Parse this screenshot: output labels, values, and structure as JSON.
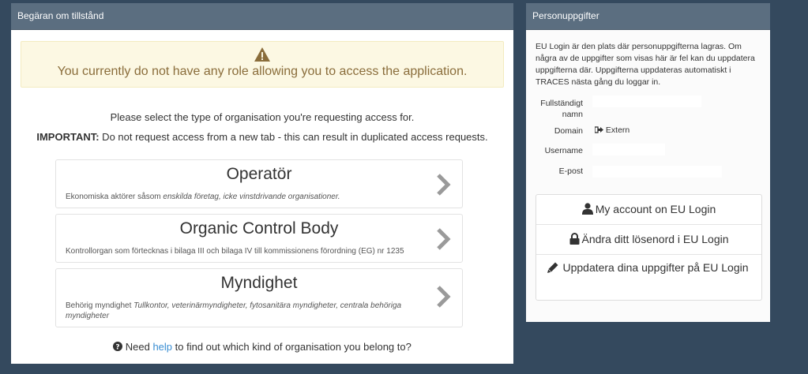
{
  "left_panel": {
    "title": "Begäran om tillstånd",
    "alert_text": "You currently do not have any role allowing you to access the application.",
    "intro": "Please select the type of organisation you're requesting access for.",
    "important_label": "IMPORTANT:",
    "important_text": " Do not request access from a new tab - this can result in duplicated access requests.",
    "orgs": [
      {
        "title": "Operatör",
        "desc_plain": "Ekonomiska aktörer såsom ",
        "desc_italic": "enskilda företag, icke vinstdrivande organisationer."
      },
      {
        "title": "Organic Control Body",
        "desc_plain": "Kontrollorgan som förtecknas i bilaga III och bilaga IV till kommissionens förordning (EG) nr 1235",
        "desc_italic": ""
      },
      {
        "title": "Myndighet",
        "desc_plain": "Behörig myndighet ",
        "desc_italic": "Tullkontor, veterinärmyndigheter, fytosanitära myndigheter, centrala behöriga myndigheter"
      }
    ],
    "help_prefix": " Need ",
    "help_link": "help",
    "help_suffix": " to find out which kind of organisation you belong to?"
  },
  "right_panel": {
    "title": "Personuppgifter",
    "info": "EU Login är den plats där personuppgifterna lagras. Om några av de uppgifter som visas här är fel kan du uppdatera uppgifterna där. Uppgifterna uppdateras automatiskt i TRACES nästa gång du loggar in.",
    "fields": {
      "fullname_label": "Fullständigt namn",
      "domain_label": "Domain",
      "domain_value": "Extern",
      "username_label": "Username",
      "email_label": "E-post"
    },
    "buttons": {
      "account": "My account on EU Login",
      "password": "Ändra ditt lösenord i EU Login",
      "update": "Uppdatera dina uppgifter på EU Login"
    }
  },
  "colors": {
    "background": "#34495e",
    "panel_heading": "#5b6e80",
    "alert_bg": "#fcf8e3",
    "alert_text": "#8a6d3b",
    "link": "#3a8ed3"
  }
}
